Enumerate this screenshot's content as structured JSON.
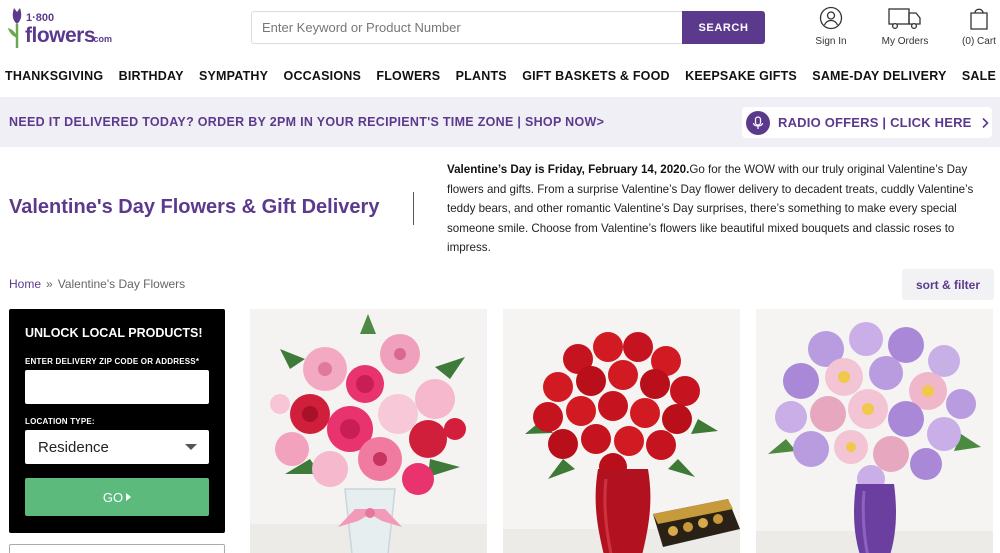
{
  "brand": {
    "logo_number": "1·800",
    "logo_name": "flowers",
    "logo_suffix": ".com",
    "color": "#5b3a8e"
  },
  "search": {
    "placeholder": "Enter Keyword or Product Number",
    "button_label": "SEARCH"
  },
  "header_links": {
    "sign_in": "Sign In",
    "my_orders": "My Orders",
    "cart": "(0) Cart"
  },
  "nav": {
    "items": [
      "THANKSGIVING",
      "BIRTHDAY",
      "SYMPATHY",
      "OCCASIONS",
      "FLOWERS",
      "PLANTS",
      "GIFT BASKETS & FOOD",
      "KEEPSAKE GIFTS",
      "SAME-DAY DELIVERY",
      "SALE"
    ]
  },
  "promo": {
    "text": "NEED IT DELIVERED TODAY? ORDER BY 2PM IN YOUR RECIPIENT'S TIME ZONE | SHOP NOW>",
    "radio_label": "RADIO OFFERS | CLICK HERE"
  },
  "page": {
    "title": "Valentine's Day Flowers & Gift Delivery",
    "intro_bold": "Valentine’s Day is Friday, February 14, 2020.",
    "intro_text": "Go for the WOW with our truly original Valentine’s Day flowers and gifts. From a surprise Valentine’s Day flower delivery to decadent treats, cuddly Valentine’s teddy bears, and other romantic Valentine’s Day surprises, there’s something to make every special someone smile. Choose from Valentine’s flowers like beautiful mixed bouquets and classic roses to impress."
  },
  "breadcrumb": {
    "home": "Home",
    "separator": "»",
    "current": "Valentine's Day Flowers"
  },
  "sort_filter": "sort & filter",
  "zip_panel": {
    "title": "UNLOCK LOCAL PRODUCTS!",
    "zip_label": "ENTER DELIVERY ZIP CODE OR ADDRESS*",
    "zip_value": "",
    "location_label": "LOCATION TYPE:",
    "location_value": "Residence",
    "go_label": "GO"
  },
  "products": [
    {
      "image": "pink-lily-rose-bouquet-in-vase"
    },
    {
      "image": "red-rose-bouquet-with-chocolates"
    },
    {
      "image": "lavender-daisy-bouquet-in-purple-vase"
    }
  ]
}
